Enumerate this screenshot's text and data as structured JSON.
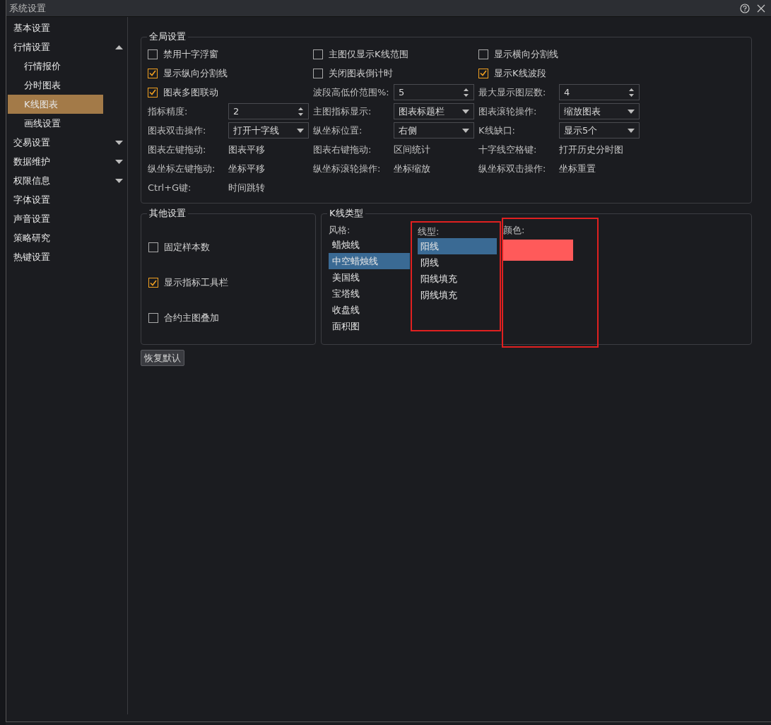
{
  "window": {
    "title": "系统设置"
  },
  "sidebar": {
    "items": [
      {
        "label": "基本设置",
        "kind": "item",
        "selected": false
      },
      {
        "label": "行情设置",
        "kind": "group",
        "selected": false,
        "expanded": true,
        "children": [
          {
            "label": "行情报价",
            "selected": false
          },
          {
            "label": "分时图表",
            "selected": false
          },
          {
            "label": "K线图表",
            "selected": true
          },
          {
            "label": "画线设置",
            "selected": false
          }
        ]
      },
      {
        "label": "交易设置",
        "kind": "group",
        "selected": false,
        "expanded": false
      },
      {
        "label": "数据维护",
        "kind": "group",
        "selected": false,
        "expanded": false
      },
      {
        "label": "权限信息",
        "kind": "group",
        "selected": false,
        "expanded": false
      },
      {
        "label": "字体设置",
        "kind": "item",
        "selected": false
      },
      {
        "label": "声音设置",
        "kind": "item",
        "selected": false
      },
      {
        "label": "策略研究",
        "kind": "item",
        "selected": false
      },
      {
        "label": "热键设置",
        "kind": "item",
        "selected": false
      }
    ]
  },
  "global_settings": {
    "title": "全局设置",
    "rows": [
      [
        {
          "kind": "checkbox",
          "label": "禁用十字浮窗",
          "checked": false
        },
        {
          "kind": "checkbox",
          "label": "主图仅显示K线范围",
          "checked": false
        },
        {
          "kind": "checkbox",
          "label": "显示横向分割线",
          "checked": false
        }
      ],
      [
        {
          "kind": "checkbox",
          "label": "显示纵向分割线",
          "checked": true
        },
        {
          "kind": "checkbox",
          "label": "关闭图表倒计时",
          "checked": false
        },
        {
          "kind": "checkbox",
          "label": "显示K线波段",
          "checked": true
        }
      ],
      [
        {
          "kind": "checkbox",
          "label": "图表多图联动",
          "checked": true
        },
        {
          "kind": "spinner",
          "label": "波段高低价范围%:",
          "value": "5"
        },
        {
          "kind": "spinner",
          "label": "最大显示图层数:",
          "value": "4"
        }
      ],
      [
        {
          "kind": "spinner",
          "label": "指标精度:",
          "value": "2"
        },
        {
          "kind": "dropdown",
          "label": "主图指标显示:",
          "value": "图表标题栏"
        },
        {
          "kind": "dropdown",
          "label": "图表滚轮操作:",
          "value": "缩放图表"
        }
      ],
      [
        {
          "kind": "dropdown",
          "label": "图表双击操作:",
          "value": "打开十字线"
        },
        {
          "kind": "dropdown",
          "label": "纵坐标位置:",
          "value": "右侧"
        },
        {
          "kind": "dropdown",
          "label": "K线缺口:",
          "value": "显示5个"
        }
      ],
      [
        {
          "kind": "text",
          "label": "图表左键拖动:",
          "value": "图表平移"
        },
        {
          "kind": "text",
          "label": "图表右键拖动:",
          "value": "区间统计"
        },
        {
          "kind": "text",
          "label": "十字线空格键:",
          "value": "打开历史分时图"
        }
      ],
      [
        {
          "kind": "text",
          "label": "纵坐标左键拖动:",
          "value": "坐标平移"
        },
        {
          "kind": "text",
          "label": "纵坐标滚轮操作:",
          "value": "坐标缩放"
        },
        {
          "kind": "text",
          "label": "纵坐标双击操作:",
          "value": "坐标重置"
        }
      ],
      [
        {
          "kind": "text",
          "label": "Ctrl+G键:",
          "value": "时间跳转"
        }
      ]
    ]
  },
  "other_settings": {
    "title": "其他设置",
    "checkboxes": [
      {
        "label": "固定样本数",
        "checked": false
      },
      {
        "label": "显示指标工具栏",
        "checked": true
      },
      {
        "label": "合约主图叠加",
        "checked": false
      }
    ]
  },
  "kline_type": {
    "title": "K线类型",
    "style": {
      "label": "风格:",
      "items": [
        {
          "label": "蜡烛线",
          "selected": false
        },
        {
          "label": "中空蜡烛线",
          "selected": true
        },
        {
          "label": "美国线",
          "selected": false
        },
        {
          "label": "宝塔线",
          "selected": false
        },
        {
          "label": "收盘线",
          "selected": false
        },
        {
          "label": "面积图",
          "selected": false
        }
      ]
    },
    "line_type": {
      "label": "线型:",
      "items": [
        {
          "label": "阳线",
          "selected": true
        },
        {
          "label": "阴线",
          "selected": false
        },
        {
          "label": "阳线填充",
          "selected": false
        },
        {
          "label": "阴线填充",
          "selected": false
        }
      ]
    },
    "color": {
      "label": "颜色:",
      "color": "#ff5a5a"
    }
  },
  "reset_button": {
    "label": "恢复默认"
  }
}
